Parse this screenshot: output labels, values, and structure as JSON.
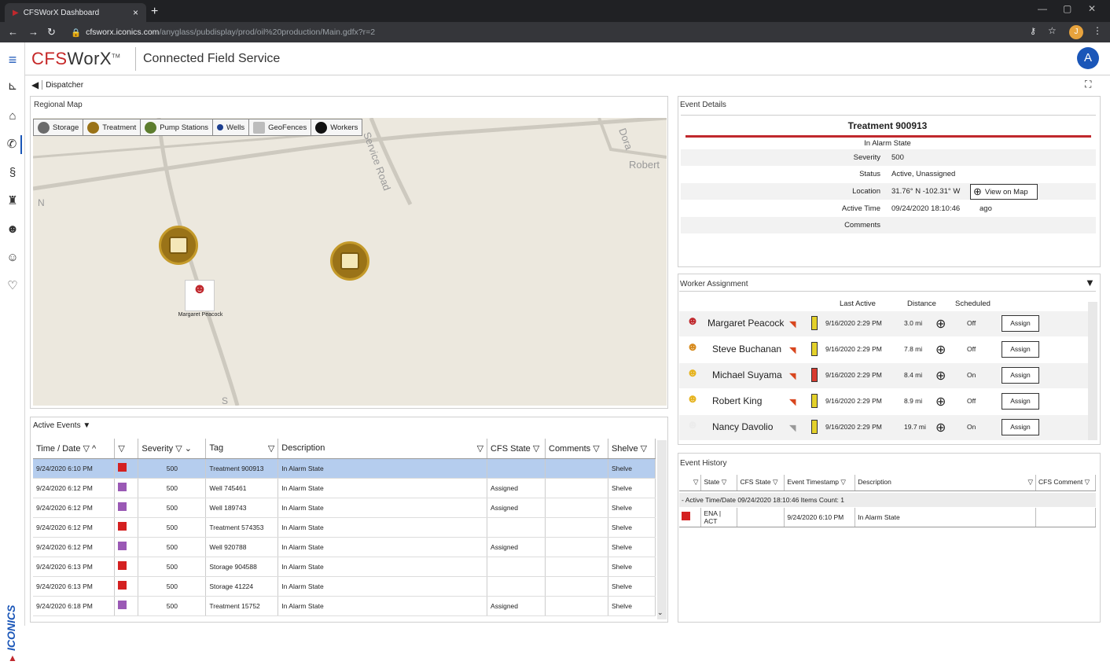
{
  "browser": {
    "tab_title": "CFSWorX Dashboard",
    "tab_close": "×",
    "new_tab": "+",
    "url_host": "cfsworx.iconics.com",
    "url_path": "/anyglass/pubdisplay/prod/oil%20production/Main.gdfx?r=2",
    "profile_initial": "J"
  },
  "header": {
    "logo_red": "CFS",
    "logo_dark": "WorX",
    "logo_tm": "TM",
    "title": "Connected Field Service",
    "avatar": "A"
  },
  "breadcrumb": {
    "label": "Dispatcher"
  },
  "map": {
    "title": "Regional Map",
    "legend": [
      {
        "label": "Storage",
        "color": "#6b6b6b"
      },
      {
        "label": "Treatment",
        "color": "#9a7318"
      },
      {
        "label": "Pump Stations",
        "color": "#5d7d2e"
      },
      {
        "label": "Wells",
        "color": "#1d3f8f"
      },
      {
        "label": "GeoFences",
        "color": "#bdbdbd"
      },
      {
        "label": "Workers",
        "color": "#111111"
      }
    ],
    "road_labels": [
      "Service Road",
      "Dora",
      "Robert",
      "N",
      "S"
    ],
    "worker_label": "Margaret Peacock"
  },
  "events": {
    "title": "Active Events ▼",
    "columns": [
      "Time / Date",
      "",
      "Severity",
      "Tag",
      "Description",
      "CFS State",
      "Comments",
      "Shelve"
    ],
    "rows": [
      {
        "time": "9/24/2020 6:10 PM",
        "color": "#d42020",
        "severity": "500",
        "tag": "Treatment 900913",
        "description": "In Alarm State",
        "cfs_state": "",
        "comments": "",
        "shelve": "Shelve"
      },
      {
        "time": "9/24/2020 6:12 PM",
        "color": "#9a59b5",
        "severity": "500",
        "tag": "Well 745461",
        "description": "In Alarm State",
        "cfs_state": "Assigned",
        "comments": "",
        "shelve": "Shelve"
      },
      {
        "time": "9/24/2020 6:12 PM",
        "color": "#9a59b5",
        "severity": "500",
        "tag": "Well 189743",
        "description": "In Alarm State",
        "cfs_state": "Assigned",
        "comments": "",
        "shelve": "Shelve"
      },
      {
        "time": "9/24/2020 6:12 PM",
        "color": "#d42020",
        "severity": "500",
        "tag": "Treatment 574353",
        "description": "In Alarm State",
        "cfs_state": "",
        "comments": "",
        "shelve": "Shelve"
      },
      {
        "time": "9/24/2020 6:12 PM",
        "color": "#9a59b5",
        "severity": "500",
        "tag": "Well 920788",
        "description": "In Alarm State",
        "cfs_state": "Assigned",
        "comments": "",
        "shelve": "Shelve"
      },
      {
        "time": "9/24/2020 6:13 PM",
        "color": "#d42020",
        "severity": "500",
        "tag": "Storage 904588",
        "description": "In Alarm State",
        "cfs_state": "",
        "comments": "",
        "shelve": "Shelve"
      },
      {
        "time": "9/24/2020 6:13 PM",
        "color": "#d42020",
        "severity": "500",
        "tag": "Storage 41224",
        "description": "In Alarm State",
        "cfs_state": "",
        "comments": "",
        "shelve": "Shelve"
      },
      {
        "time": "9/24/2020 6:18 PM",
        "color": "#9a59b5",
        "severity": "500",
        "tag": "Treatment 15752",
        "description": "In Alarm State",
        "cfs_state": "Assigned",
        "comments": "",
        "shelve": "Shelve"
      }
    ]
  },
  "details": {
    "title": "Event Details",
    "name": "Treatment 900913",
    "state": "In Alarm State",
    "severity_label": "Severity",
    "severity": "500",
    "status_label": "Status",
    "status": "Active, Unassigned",
    "location_label": "Location",
    "location": "31.76° N  -102.31° W",
    "view_map": "View on Map",
    "active_time_label": "Active Time",
    "active_time": "09/24/2020 18:10:46",
    "ago": "ago",
    "comments_label": "Comments"
  },
  "workers": {
    "title": "Worker Assignment",
    "col_last_active": "Last Active",
    "col_distance": "Distance",
    "col_scheduled": "Scheduled",
    "assign_label": "Assign",
    "list": [
      {
        "name": "Margaret Peacock",
        "last_active": "9/16/2020 2:29 PM",
        "distance": "3.0 mi",
        "scheduled": "Off",
        "battery": "yellow"
      },
      {
        "name": "Steve Buchanan",
        "last_active": "9/16/2020 2:29 PM",
        "distance": "7.8 mi",
        "scheduled": "Off",
        "battery": "yellow"
      },
      {
        "name": "Michael Suyama",
        "last_active": "9/16/2020 2:29 PM",
        "distance": "8.4 mi",
        "scheduled": "On",
        "battery": "red"
      },
      {
        "name": "Robert King",
        "last_active": "9/16/2020 2:29 PM",
        "distance": "8.9 mi",
        "scheduled": "Off",
        "battery": "yellow"
      },
      {
        "name": "Nancy Davolio",
        "last_active": "9/16/2020 2:29 PM",
        "distance": "19.7 mi",
        "scheduled": "On",
        "battery": "yellow"
      }
    ]
  },
  "history": {
    "title": "Event History",
    "columns": [
      "",
      "State",
      "CFS State",
      "Event Timestamp",
      "Description",
      "CFS Comment"
    ],
    "group": "- Active Time/Date 09/24/2020 18:10:46 Items Count: 1",
    "rows": [
      {
        "color": "#d42020",
        "state": "ENA | ACT",
        "cfs_state": "",
        "timestamp": "9/24/2020 6:10 PM",
        "description": "In Alarm State",
        "comment": ""
      }
    ]
  },
  "brand": "ICONICS"
}
